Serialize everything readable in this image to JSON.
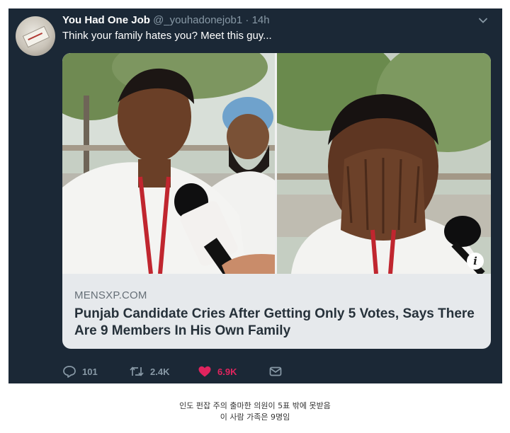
{
  "tweet": {
    "display_name": "You Had One Job",
    "handle": "@_youhadonejob1",
    "separator": "·",
    "time": "14h",
    "text": "Think your family hates you? Meet this guy..."
  },
  "card": {
    "site": "MENSXP.COM",
    "headline": "Punjab Candidate Cries After Getting Only 5 Votes, Says There Are 9 Members In His Own Family",
    "info_label": "i"
  },
  "actions": {
    "replies": "101",
    "retweets": "2.4K",
    "likes": "6.9K"
  },
  "caption": {
    "line1": "인도 펀잡 주의 출마한 의원이 5표 밖에 못받음",
    "line2": "이 사람 가족은 9명임"
  },
  "colors": {
    "tweet_bg": "#1b2836",
    "secondary_text": "#8899a6",
    "like": "#e0245e",
    "card_bg": "#e6e9ec"
  },
  "icons": [
    "chevron-down-icon",
    "reply-icon",
    "retweet-icon",
    "heart-icon",
    "message-icon",
    "info-icon"
  ]
}
